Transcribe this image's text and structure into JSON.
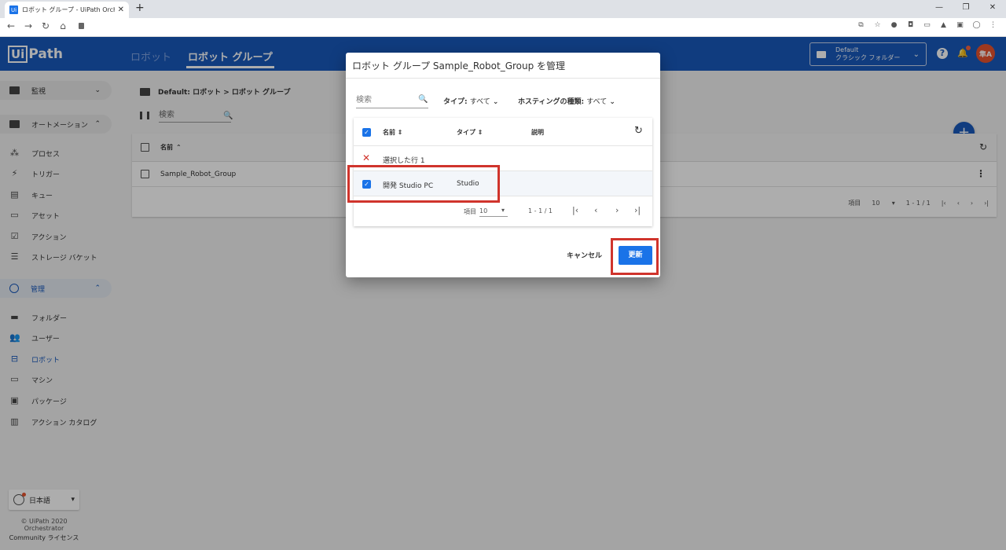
{
  "browser": {
    "tab_title": "ロボット グループ - UiPath Orchestra",
    "tab_favicon": "Ui",
    "close": "✕",
    "new_tab": "+",
    "win_min": "—",
    "win_max": "❐",
    "win_close": "✕"
  },
  "header": {
    "logo_box": "Ui",
    "logo_rest": "Path",
    "tab_inactive": "ロボット",
    "tab_active": "ロボット グループ",
    "folder_line1": "Default",
    "folder_line2": "クラシック フォルダー",
    "avatar": "隼A",
    "colors": {
      "appbar": "#1859bc",
      "accent": "#1a73e8",
      "highlight": "#d0342c"
    }
  },
  "sidebar": {
    "monitor": "監視",
    "automation": "オートメーション",
    "automation_items": [
      "プロセス",
      "トリガー",
      "キュー",
      "アセット",
      "アクション",
      "ストレージ バケット"
    ],
    "admin": "管理",
    "admin_items": [
      "フォルダー",
      "ユーザー",
      "ロボット",
      "マシン",
      "パッケージ",
      "アクション カタログ"
    ],
    "language": "日本語",
    "copyright": "© UiPath 2020",
    "product": "Orchestrator",
    "license_prefix": "Community",
    "license_suffix": "ライセンス"
  },
  "main": {
    "breadcrumb": "Default: ロボット > ロボット グループ",
    "search_placeholder": "検索",
    "col_name": "名前",
    "row_name": "Sample_Robot_Group",
    "page_items_label": "項目",
    "page_size": "10",
    "page_range": "1 - 1 / 1"
  },
  "dialog": {
    "title": "ロボット グループ Sample_Robot_Group を管理",
    "search_placeholder": "検索",
    "filter_type_label": "タイプ:",
    "filter_type_value": "すべて",
    "filter_hosting_label": "ホスティングの種類:",
    "filter_hosting_value": "すべて",
    "col_name": "名前",
    "col_type": "タイプ",
    "col_desc": "説明",
    "selected_rows": "選択した行 1",
    "row_name": "開発 Studio PC",
    "row_type": "Studio",
    "page_items_label": "項目",
    "page_size": "10",
    "page_range": "1 - 1 / 1",
    "cancel": "キャンセル",
    "update": "更新"
  }
}
